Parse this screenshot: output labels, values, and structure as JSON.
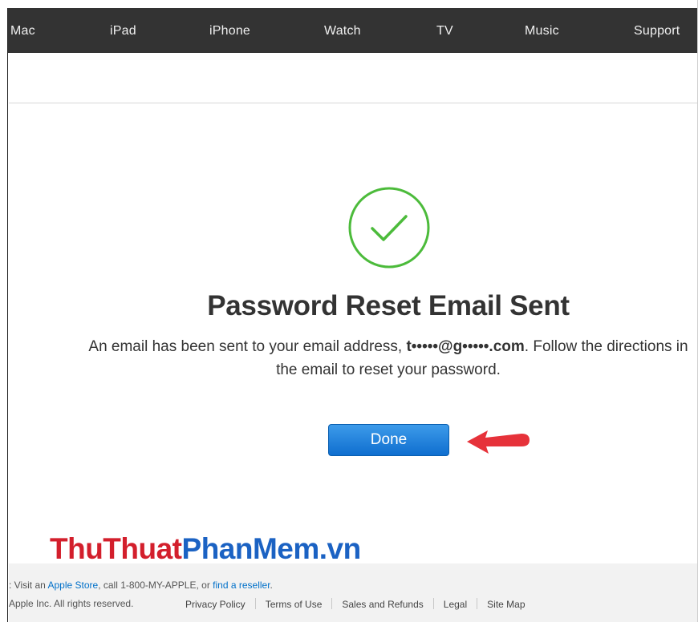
{
  "nav": {
    "items": [
      {
        "label": "Mac"
      },
      {
        "label": "iPad"
      },
      {
        "label": "iPhone"
      },
      {
        "label": "Watch"
      },
      {
        "label": "TV"
      },
      {
        "label": "Music"
      },
      {
        "label": "Support"
      }
    ]
  },
  "main": {
    "icon": "checkmark-circle-icon",
    "title": "Password Reset Email Sent",
    "message_before": "An email has been sent to your email address, ",
    "email": "t•••••@g•••••.com",
    "message_after": ". Follow the directions in the email to reset your password.",
    "done_label": "Done",
    "accent_green": "#4cbb3b",
    "button_color": "#1a7ad9",
    "arrow_color": "#e6323a"
  },
  "watermark": {
    "part1": "ThuThuat",
    "part2": "PhanMem.vn"
  },
  "footer": {
    "line1_prefix": ": Visit an ",
    "apple_store": "Apple Store",
    "line1_middle": ", call 1-800-MY-APPLE, or ",
    "find_reseller": "find a reseller",
    "line1_suffix": ".",
    "copyright": "Apple Inc. All rights reserved.",
    "links": [
      "Privacy Policy",
      "Terms of Use",
      "Sales and Refunds",
      "Legal",
      "Site Map"
    ]
  }
}
